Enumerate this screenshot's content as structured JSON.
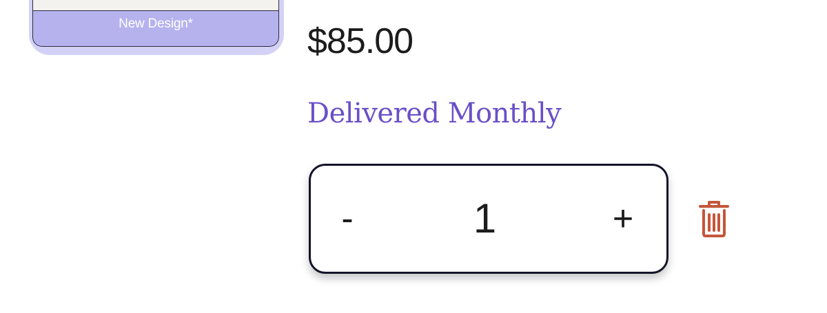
{
  "product": {
    "thumbnail_label": "New Design*",
    "price": "$85.00",
    "frequency": "Delivered Monthly"
  },
  "quantity": {
    "decrement_label": "-",
    "value": "1",
    "increment_label": "+"
  },
  "icons": {
    "delete": "trash-icon"
  },
  "colors": {
    "accent_purple": "#6a4fc7",
    "thumbnail_lavender": "#b6b2ee",
    "delete_red": "#c4563a",
    "border_dark": "#14142a"
  }
}
